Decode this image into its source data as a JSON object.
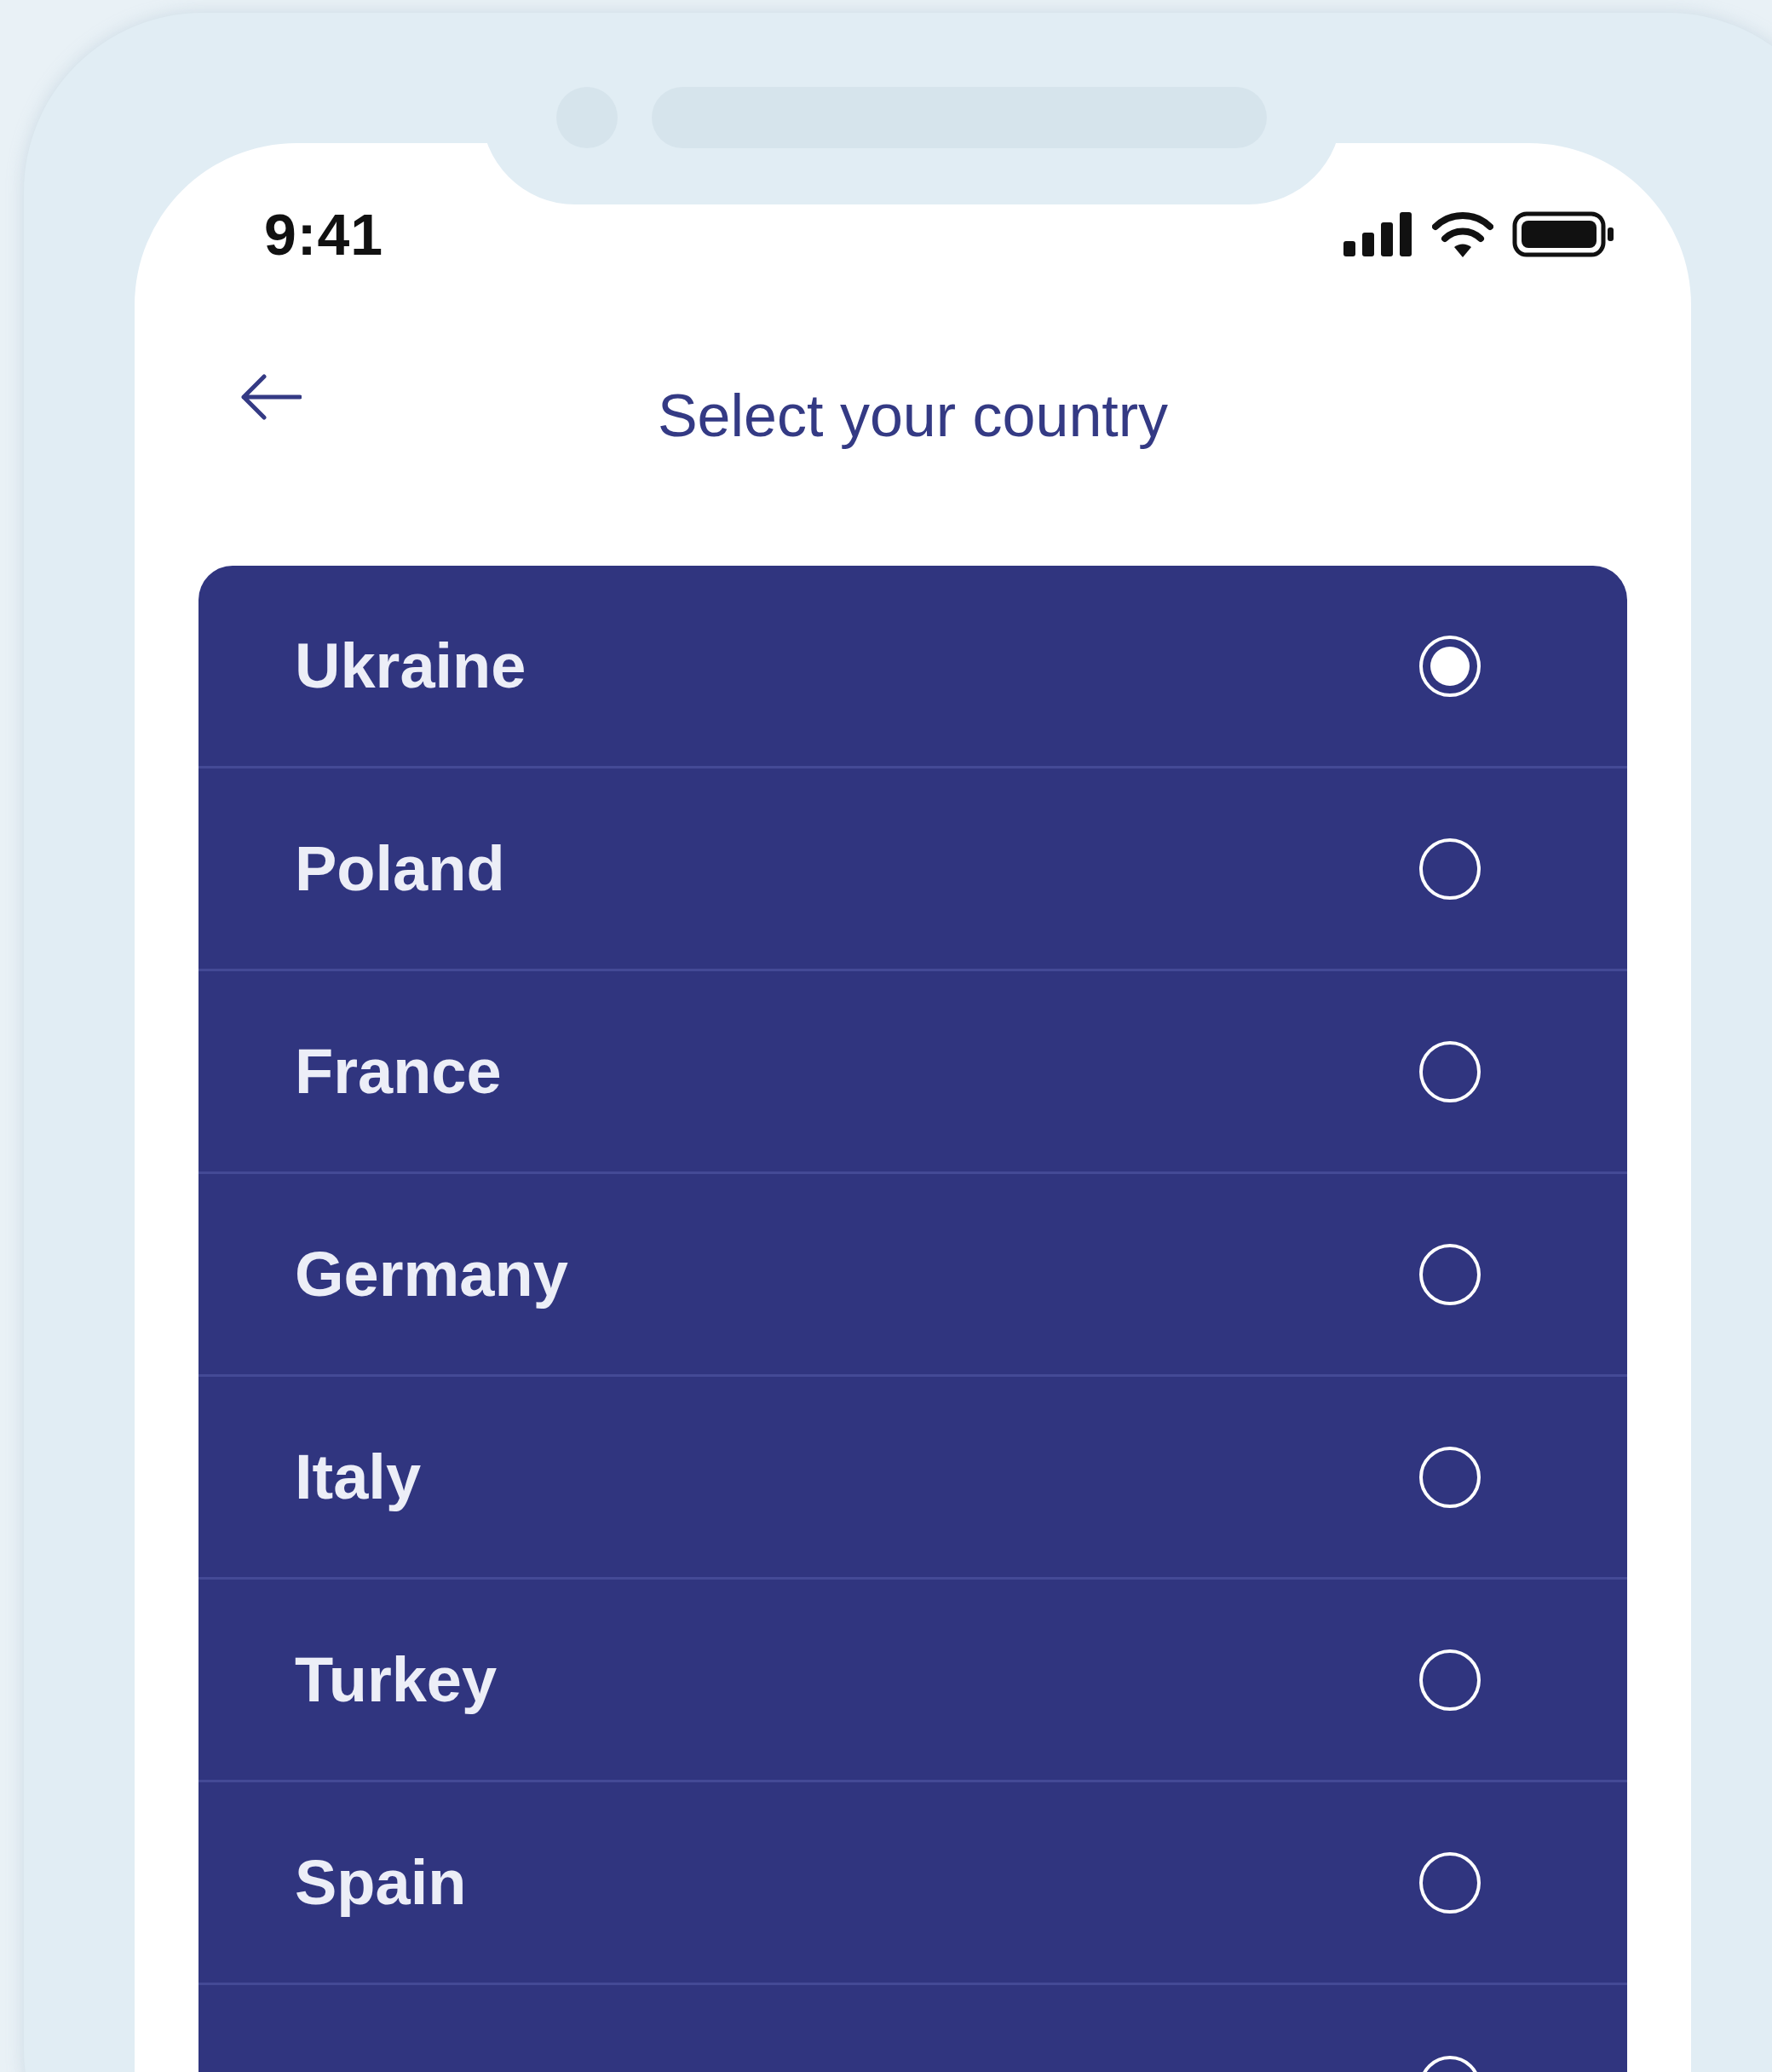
{
  "status_bar": {
    "time": "9:41"
  },
  "header": {
    "title": "Select your country"
  },
  "countries": [
    {
      "name": "Ukraine",
      "selected": true
    },
    {
      "name": "Poland",
      "selected": false
    },
    {
      "name": "France",
      "selected": false
    },
    {
      "name": "Germany",
      "selected": false
    },
    {
      "name": "Italy",
      "selected": false
    },
    {
      "name": "Turkey",
      "selected": false
    },
    {
      "name": "Spain",
      "selected": false
    },
    {
      "selected": false
    }
  ]
}
